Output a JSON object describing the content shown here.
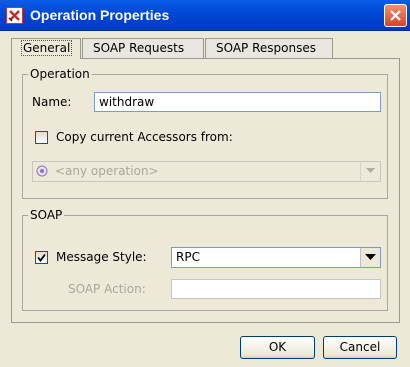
{
  "window": {
    "title": "Operation Properties"
  },
  "tabs": [
    {
      "label": "General",
      "active": true
    },
    {
      "label": "SOAP Requests",
      "active": false
    },
    {
      "label": "SOAP Responses",
      "active": false
    }
  ],
  "operation_group": {
    "title": "Operation",
    "name_label": "Name:",
    "name_value": "withdraw",
    "copy_checkbox_label": "Copy current Accessors from:",
    "copy_checked": false,
    "copy_from_value": "<any operation>",
    "copy_from_enabled": false
  },
  "soap_group": {
    "title": "SOAP",
    "message_style_label": "Message Style:",
    "message_style_checked": true,
    "message_style_value": "RPC",
    "soap_action_label": "SOAP Action:",
    "soap_action_value": ""
  },
  "buttons": {
    "ok": "OK",
    "cancel": "Cancel"
  },
  "colors": {
    "titlebar": "#0047d4",
    "close": "#d4432a",
    "dialog_bg": "#ece9d8"
  },
  "icons": {
    "app": "app-x-icon",
    "close": "close-icon",
    "operation": "operation-icon",
    "dropdown": "chevron-down-icon",
    "check": "check-icon"
  }
}
